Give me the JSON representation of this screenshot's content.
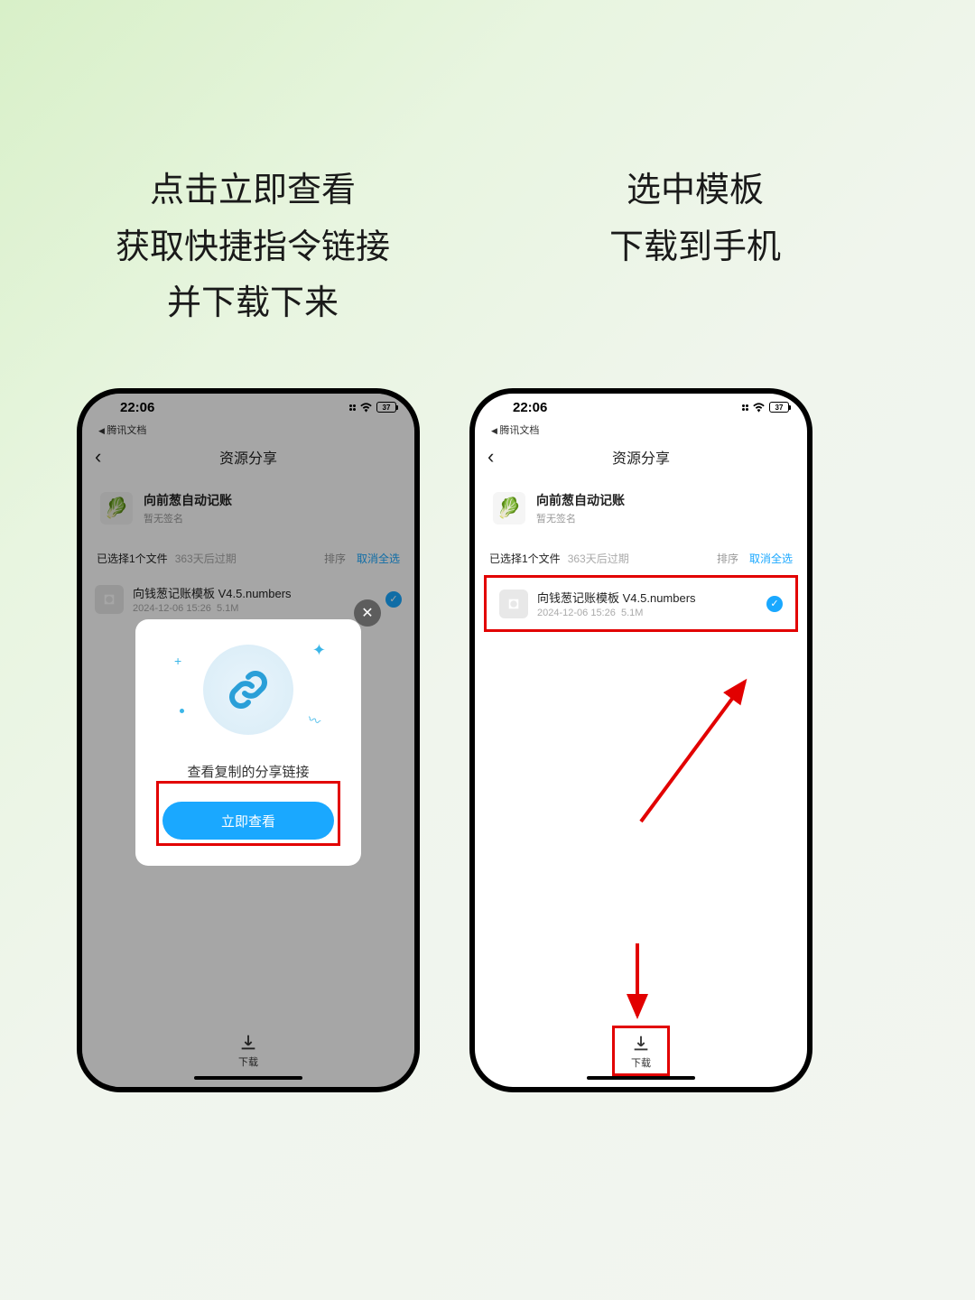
{
  "captions": {
    "left": "点击立即查看\n获取快捷指令链接\n并下载下来",
    "right": "选中模板\n下载到手机"
  },
  "status": {
    "time": "22:06",
    "battery": "37"
  },
  "breadcrumb": "腾讯文档",
  "nav": {
    "title": "资源分享"
  },
  "profile": {
    "name": "向前葱自动记账",
    "sub": "暂无签名"
  },
  "selection": {
    "count": "已选择1个文件",
    "expire": "363天后过期",
    "sort": "排序",
    "cancel": "取消全选"
  },
  "file": {
    "name": "向钱葱记账模板 V4.5.numbers",
    "date": "2024-12-06 15:26",
    "size": "5.1M"
  },
  "modal": {
    "text": "查看复制的分享链接",
    "button": "立即查看"
  },
  "download": {
    "label": "下载"
  }
}
